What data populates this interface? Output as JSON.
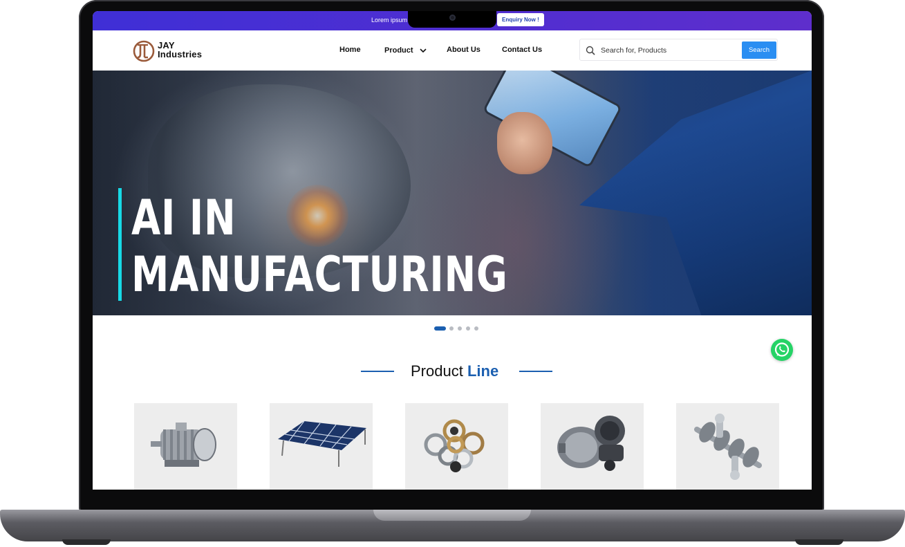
{
  "topbar": {
    "text": "Lorem ipsum d",
    "enquiry_label": "Enquiry Now !"
  },
  "brand": {
    "name_line1": "JAY",
    "name_line2": "Industries",
    "logo_color": "#9a5a3a"
  },
  "nav": {
    "items": [
      {
        "label": "Home"
      },
      {
        "label": "Product"
      },
      {
        "label": "About Us"
      },
      {
        "label": "Contact Us"
      }
    ]
  },
  "search": {
    "placeholder": "Search for, Products",
    "button_label": "Search",
    "icon": "search-icon"
  },
  "hero": {
    "title_line1": "AI IN",
    "title_line2": "MANUFACTURING",
    "accent_color": "#17d9e6"
  },
  "carousel": {
    "slide_count": 5,
    "active_index": 0
  },
  "product_line": {
    "heading_prefix": "Product",
    "heading_accent": "Line",
    "accent_color": "#1b5fb0",
    "products": [
      {
        "image": "electric-motor"
      },
      {
        "image": "solar-panel-array"
      },
      {
        "image": "ball-bearings"
      },
      {
        "image": "gearbox"
      },
      {
        "image": "crankshaft-assembly"
      }
    ]
  },
  "floating": {
    "chat_icon": "whatsapp-icon"
  }
}
